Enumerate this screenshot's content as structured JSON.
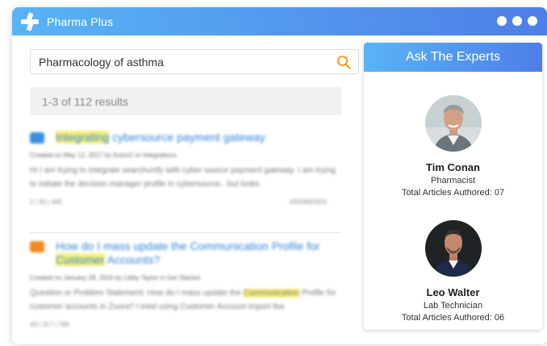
{
  "app": {
    "title": "Pharma Plus"
  },
  "search": {
    "query": "Pharmacology of asthma"
  },
  "results": {
    "summary": "1-3 of 112 results",
    "items": [
      {
        "title_highlight": "Integrating",
        "title_rest": " cybersource payment gateway",
        "meta": "Created on May 12, 2017 by ActonC in Integrations",
        "snippet": "Hi I am trying to integrate searchunify with cyber source payment gateway. I am trying to initiate the decision manager profile in cybersource.. but looks",
        "stats_left": "2  |  43  |  340",
        "stats_right": "ANSWERED"
      },
      {
        "title_pre": "How do I mass update the Communication Profile for ",
        "title_highlight": "Customer",
        "title_post": " Accounts?",
        "meta": "Created on January 28, 2016 by Libby Taylor in Get Started",
        "snippet_pre": "Question or Problem Statement: How do I mass update the ",
        "snippet_highlight": "Communication",
        "snippet_post": " Profile for customer accounts in Zuora? I tried using Customer Account import fea",
        "stats_left": "43  |  317  |  796"
      }
    ]
  },
  "experts": {
    "header": "Ask The Experts",
    "list": [
      {
        "name": "Tim Conan",
        "role": "Pharmacist",
        "articles": "Total Articles Authored: 07"
      },
      {
        "name": "Leo Walter",
        "role": "Lab Technician",
        "articles": "Total Articles Authored: 06"
      }
    ]
  },
  "colors": {
    "brand_gradient_start": "#58b4f5",
    "brand_gradient_end": "#4e7ee8",
    "link": "#2f83d8",
    "highlight": "#f6f07a",
    "search_icon": "#f0a020"
  },
  "icons": {
    "logo": "plus-cross-logo-icon",
    "search": "search-icon",
    "window_controls": "dot-icon"
  }
}
